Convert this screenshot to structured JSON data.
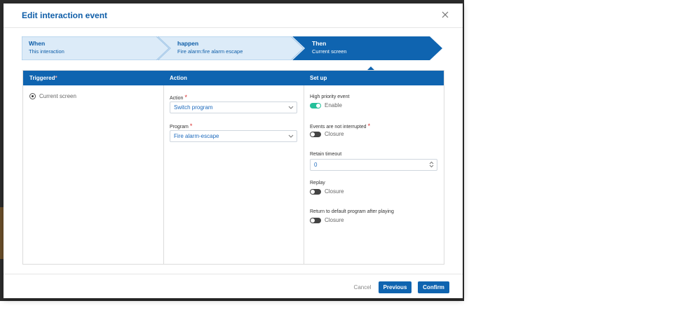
{
  "dialog": {
    "title": "Edit interaction event"
  },
  "steps": [
    {
      "title": "When",
      "subtitle": "This interaction"
    },
    {
      "title": "happen",
      "subtitle": "Fire alarm:fire alarm escape"
    },
    {
      "title": "Then",
      "subtitle": "Current screen"
    }
  ],
  "columns": {
    "triggered": "Triggered",
    "triggered_required": "*",
    "action": "Action",
    "setup": "Set up"
  },
  "triggered": {
    "option_label": "Current screen",
    "selected": true
  },
  "action": {
    "action_label": "Action",
    "action_value": "Switch program",
    "program_label": "Program",
    "program_value": "Fire alarm-escape",
    "required_mark": "*"
  },
  "setup": {
    "high_priority_label": "High priority event",
    "high_priority_state": "Enable",
    "high_priority_on": true,
    "not_interrupted_label": "Events are not interrupted",
    "not_interrupted_state": "Closure",
    "not_interrupted_on": false,
    "retain_timeout_label": "Retain timeout",
    "retain_timeout_value": "0",
    "replay_label": "Replay",
    "replay_state": "Closure",
    "replay_on": false,
    "return_default_label": "Return to default program after playing",
    "return_default_state": "Closure",
    "return_default_on": false,
    "required_mark": "*"
  },
  "footer": {
    "cancel_label": "Cancel",
    "previous_label": "Previous",
    "confirm_label": "Confirm"
  },
  "colors": {
    "primary": "#0f64b0",
    "step_inactive": "#dcebf8",
    "toggle_on": "#25c09a",
    "required": "#d92b2b"
  },
  "icons": {
    "close": "close-icon",
    "chevron": "chevron-down-icon",
    "spinner": "spinner-icon"
  }
}
